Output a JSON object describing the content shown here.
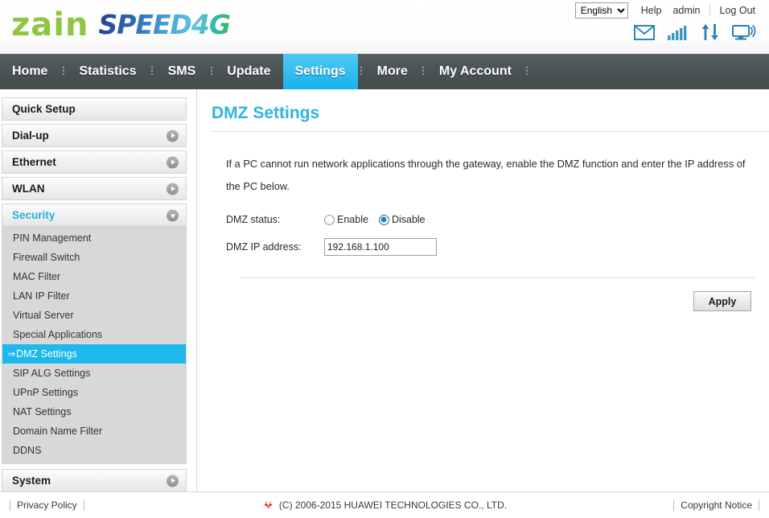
{
  "header": {
    "logo_zain": "zain",
    "logo_speed": "SPEED4G",
    "language_selected": "English",
    "language_options": [
      "English"
    ],
    "links": [
      {
        "label": "Help",
        "name": "help-link"
      },
      {
        "label": "admin",
        "name": "admin-link"
      },
      {
        "label": "Log Out",
        "name": "logout-link"
      }
    ],
    "status_icons": [
      {
        "name": "envelope-icon",
        "title": "Messages"
      },
      {
        "name": "signal-bars-icon",
        "title": "Signal"
      },
      {
        "name": "data-traffic-icon",
        "title": "Traffic"
      },
      {
        "name": "connected-device-icon",
        "title": "Device"
      }
    ]
  },
  "nav": {
    "items": [
      {
        "label": "Home",
        "active": false
      },
      {
        "label": "Statistics",
        "active": false
      },
      {
        "label": "SMS",
        "active": false
      },
      {
        "label": "Update",
        "active": false
      },
      {
        "label": "Settings",
        "active": true
      },
      {
        "label": "More",
        "active": false
      },
      {
        "label": "My Account",
        "active": false
      }
    ]
  },
  "sidebar": {
    "groups": [
      {
        "label": "Quick Setup",
        "expanded": false,
        "arrow": "none",
        "items": []
      },
      {
        "label": "Dial-up",
        "expanded": false,
        "arrow": "right",
        "items": []
      },
      {
        "label": "Ethernet",
        "expanded": false,
        "arrow": "right",
        "items": []
      },
      {
        "label": "WLAN",
        "expanded": false,
        "arrow": "right",
        "items": []
      },
      {
        "label": "Security",
        "expanded": true,
        "arrow": "down",
        "items": [
          {
            "label": "PIN Management",
            "selected": false
          },
          {
            "label": "Firewall Switch",
            "selected": false
          },
          {
            "label": "MAC Filter",
            "selected": false
          },
          {
            "label": "LAN IP Filter",
            "selected": false
          },
          {
            "label": "Virtual Server",
            "selected": false
          },
          {
            "label": "Special Applications",
            "selected": false
          },
          {
            "label": "DMZ Settings",
            "selected": true
          },
          {
            "label": "SIP ALG Settings",
            "selected": false
          },
          {
            "label": "UPnP Settings",
            "selected": false
          },
          {
            "label": "NAT Settings",
            "selected": false
          },
          {
            "label": "Domain Name Filter",
            "selected": false
          },
          {
            "label": "DDNS",
            "selected": false
          }
        ]
      },
      {
        "label": "System",
        "expanded": false,
        "arrow": "right",
        "items": []
      }
    ],
    "selected_marker": "⇒"
  },
  "main": {
    "title": "DMZ Settings",
    "description": "If a PC cannot run network applications through the gateway, enable the DMZ function and enter the IP address of the PC below.",
    "dmz_status_label": "DMZ status:",
    "dmz_status_options": [
      {
        "label": "Enable",
        "checked": false
      },
      {
        "label": "Disable",
        "checked": true
      }
    ],
    "dmz_ip_label": "DMZ IP address:",
    "dmz_ip_value": "192.168.1.100",
    "dmz_ip_placeholder": "",
    "apply_label": "Apply"
  },
  "footer": {
    "privacy_policy": "Privacy Policy",
    "copyright": "(C) 2006-2015 HUAWEI TECHNOLOGIES CO., LTD.",
    "copyright_notice": "Copyright Notice"
  },
  "colors": {
    "accent_cyan": "#2fb4dd",
    "nav_active": "#1eb8ec",
    "nav_bg": "#4b5455",
    "zain_green": "#8ec63f",
    "huawei_red": "#e60012"
  }
}
